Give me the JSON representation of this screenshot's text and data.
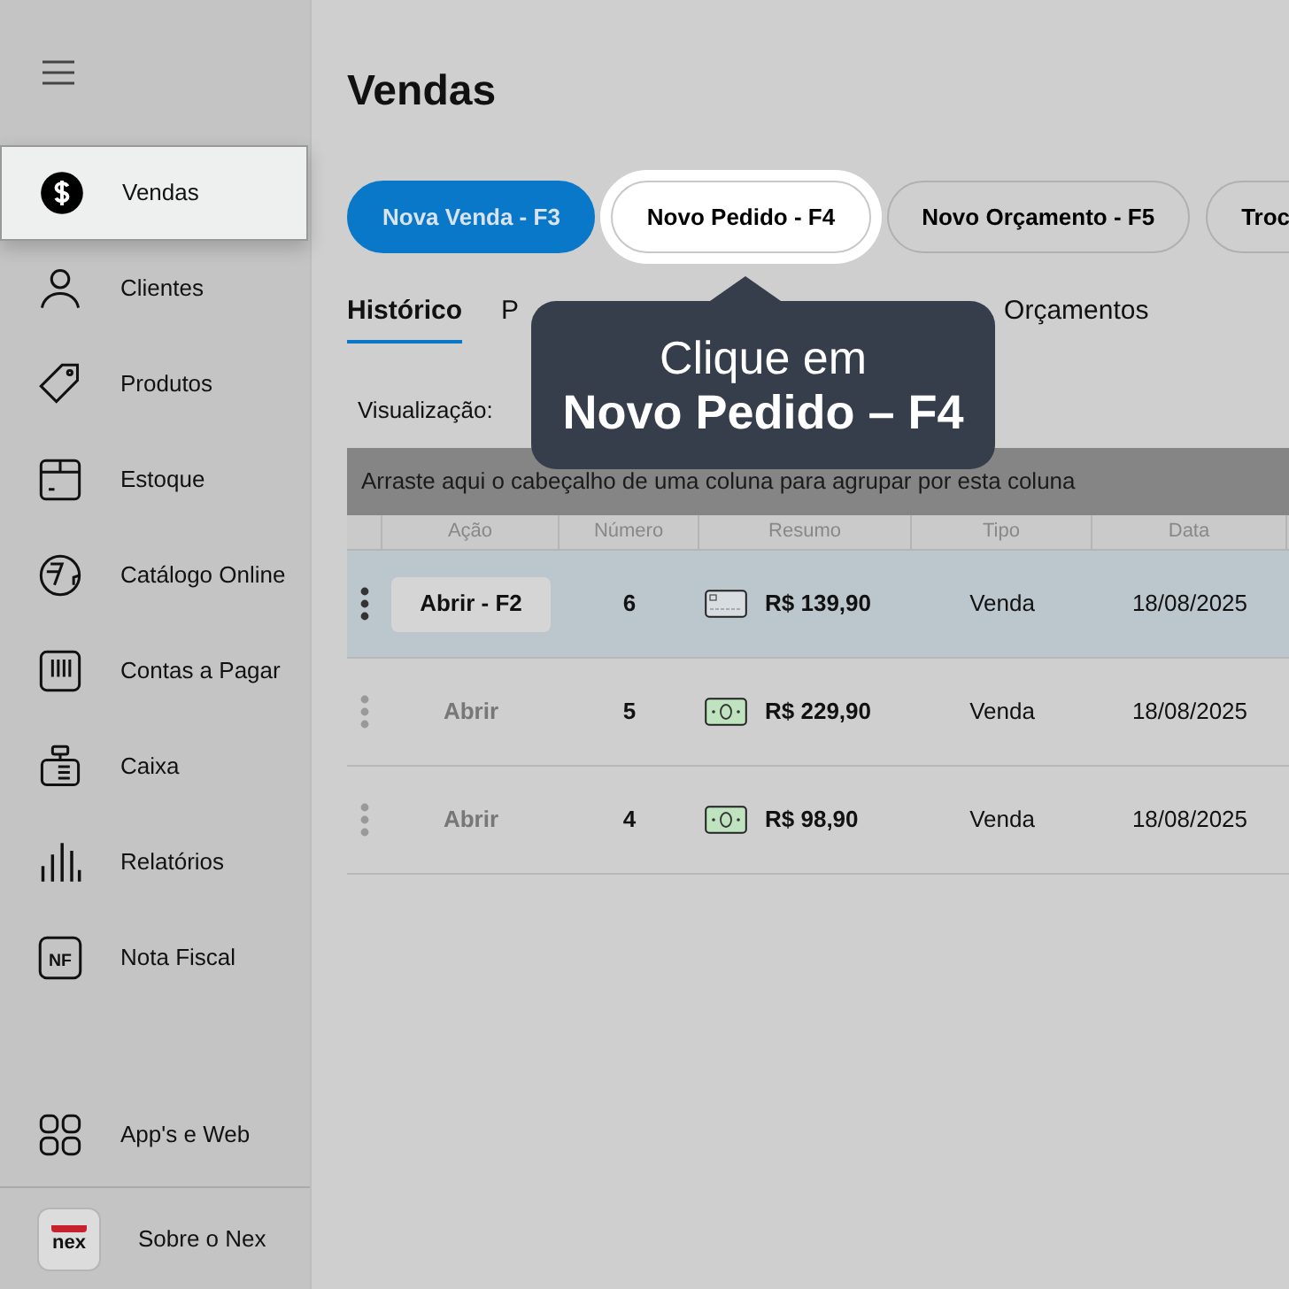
{
  "sidebar": {
    "items": [
      {
        "label": "Vendas",
        "kind": "dollar",
        "selected": true
      },
      {
        "label": "Clientes",
        "kind": "user",
        "selected": false
      },
      {
        "label": "Produtos",
        "kind": "tag",
        "selected": false
      },
      {
        "label": "Estoque",
        "kind": "box",
        "selected": false
      },
      {
        "label": "Catálogo Online",
        "kind": "catalog",
        "selected": false
      },
      {
        "label": "Contas a Pagar",
        "kind": "bills",
        "selected": false
      },
      {
        "label": "Caixa",
        "kind": "register",
        "selected": false
      },
      {
        "label": "Relatórios",
        "kind": "bars",
        "selected": false
      },
      {
        "label": "Nota Fiscal",
        "kind": "nf",
        "icon_text": "NF",
        "selected": false
      }
    ],
    "bottom_items": [
      {
        "label": "App's e Web",
        "kind": "grid"
      },
      {
        "label": "Sobre o Nex",
        "kind": "logo",
        "logo_text": "nex"
      }
    ]
  },
  "page": {
    "title": "Vendas"
  },
  "action_buttons": [
    {
      "label": "Nova Venda - F3",
      "kind": "primary"
    },
    {
      "label": "Novo Pedido - F4",
      "kind": "highlighted"
    },
    {
      "label": "Novo Orçamento - F5",
      "kind": "outline"
    },
    {
      "label": "Troc",
      "kind": "outline"
    }
  ],
  "tabs": [
    {
      "label": "Histórico",
      "selected": true
    },
    {
      "label": "P",
      "selected": false
    },
    {
      "label": "Orçamentos",
      "selected": false
    }
  ],
  "view_label": "Visualização:",
  "group_panel": "Arraste aqui o cabeçalho de uma coluna para agrupar por esta coluna",
  "table": {
    "columns": [
      "Ação",
      "Número",
      "Resumo",
      "Tipo",
      "Data"
    ],
    "rows": [
      {
        "action": "Abrir - F2",
        "number": "6",
        "kind": "card",
        "amount": "R$ 139,90",
        "type": "Venda",
        "date": "18/08/2025",
        "selected": true
      },
      {
        "action": "Abrir",
        "number": "5",
        "kind": "cash",
        "amount": "R$ 229,90",
        "type": "Venda",
        "date": "18/08/2025",
        "selected": false
      },
      {
        "action": "Abrir",
        "number": "4",
        "kind": "cash",
        "amount": "R$ 98,90",
        "type": "Venda",
        "date": "18/08/2025",
        "selected": false
      }
    ]
  },
  "tooltip": {
    "line_1": "Clique em",
    "line_2": "Novo Pedido – F4"
  }
}
